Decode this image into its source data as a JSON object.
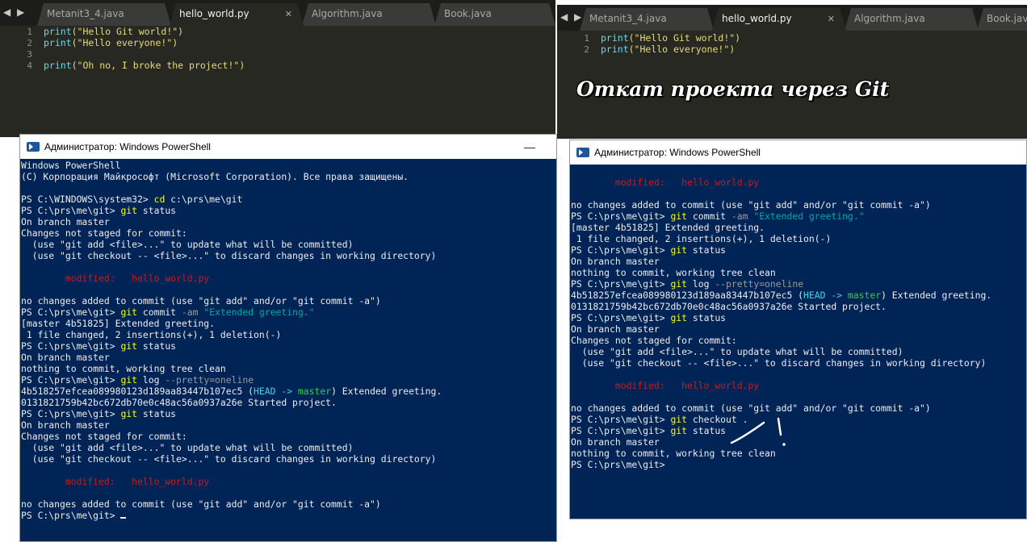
{
  "left": {
    "tabs": [
      "Metanit3_4.java",
      "hello_world.py",
      "Algorithm.java",
      "Book.java"
    ],
    "active_tab": 1,
    "code_lines": [
      {
        "num": "1",
        "fn": "print",
        "args": "(\"Hello Git world!\")"
      },
      {
        "num": "2",
        "fn": "print",
        "args": "(\"Hello everyone!\")"
      },
      {
        "num": "3",
        "fn": "",
        "args": ""
      },
      {
        "num": "4",
        "fn": "print",
        "args": "(\"Oh no, I broke the project!\")"
      }
    ]
  },
  "right": {
    "tabs": [
      "Metanit3_4.java",
      "hello_world.py",
      "Algorithm.java",
      "Book.java"
    ],
    "active_tab": 1,
    "code_lines": [
      {
        "num": "1",
        "fn": "print",
        "args": "(\"Hello Git world!\")"
      },
      {
        "num": "2",
        "fn": "print",
        "args": "(\"Hello everyone!\")"
      }
    ]
  },
  "overlay_title": "Откат проекта через Git",
  "ps_title": "Администратор: Windows PowerShell",
  "terminal_left": [
    "Windows PowerShell",
    "(C) Корпорация Майкрософт (Microsoft Corporation). Все права защищены.",
    "",
    "PS C:\\WINDOWS\\system32> |cd| c:\\prs\\me\\git",
    "PS C:\\prs\\me\\git> |git| status",
    "On branch master",
    "Changes not staged for commit:",
    "  (use \"git add <file>...\" to update what will be committed)",
    "  (use \"git checkout -- <file>...\" to discard changes in working directory)",
    "",
    "        modified:   hello_world.py",
    "",
    "no changes added to commit (use \"git add\" and/or \"git commit -a\")",
    "PS C:\\prs\\me\\git> |git| commit -am \"Extended greeting.\"",
    "[master 4b51825] Extended greeting.",
    " 1 file changed, 2 insertions(+), 1 deletion(-)",
    "PS C:\\prs\\me\\git> |git| status",
    "On branch master",
    "nothing to commit, working tree clean",
    "PS C:\\prs\\me\\git> |git| log --pretty=oneline",
    "4b518257efcea089980123d189aa83447b107ec5 (HEAD -> master) Extended greeting.",
    "0131821759b42bc672db70e0c48ac56a0937a26e Started project.",
    "PS C:\\prs\\me\\git> |git| status",
    "On branch master",
    "Changes not staged for commit:",
    "  (use \"git add <file>...\" to update what will be committed)",
    "  (use \"git checkout -- <file>...\" to discard changes in working directory)",
    "",
    "        modified:   hello_world.py",
    "",
    "no changes added to commit (use \"git add\" and/or \"git commit -a\")",
    "PS C:\\prs\\me\\git> "
  ],
  "terminal_right": [
    "        modified:   hello_world.py",
    "",
    "no changes added to commit (use \"git add\" and/or \"git commit -a\")",
    "PS C:\\prs\\me\\git> |git| commit -am \"Extended greeting.\"",
    "[master 4b51825] Extended greeting.",
    " 1 file changed, 2 insertions(+), 1 deletion(-)",
    "PS C:\\prs\\me\\git> |git| status",
    "On branch master",
    "nothing to commit, working tree clean",
    "PS C:\\prs\\me\\git> |git| log --pretty=oneline",
    "4b518257efcea089980123d189aa83447b107ec5 (HEAD -> master) Extended greeting.",
    "0131821759b42bc672db70e0c48ac56a0937a26e Started project.",
    "PS C:\\prs\\me\\git> |git| status",
    "On branch master",
    "Changes not staged for commit:",
    "  (use \"git add <file>...\" to update what will be committed)",
    "  (use \"git checkout -- <file>...\" to discard changes in working directory)",
    "",
    "        modified:   hello_world.py",
    "",
    "no changes added to commit (use \"git add\" and/or \"git commit -a\")",
    "PS C:\\prs\\me\\git> |git| checkout .",
    "PS C:\\prs\\me\\git> |git| status",
    "On branch master",
    "nothing to commit, working tree clean",
    "PS C:\\prs\\me\\git> "
  ],
  "colors": {
    "ps_bg": "#012456",
    "editor_bg": "#272822",
    "keyword": "#66d9ef",
    "string": "#e6db74",
    "modified": "#c21e1e"
  }
}
